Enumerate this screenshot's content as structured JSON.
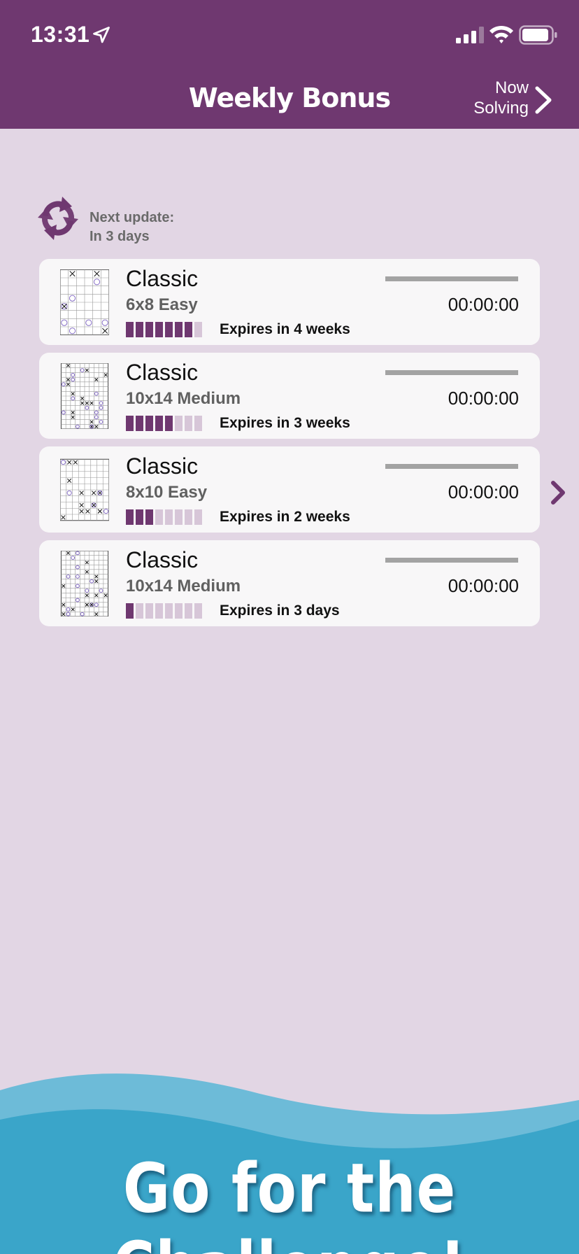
{
  "status": {
    "time": "13:31"
  },
  "header": {
    "title": "Weekly Bonus",
    "now_line1": "Now",
    "now_line2": "Solving"
  },
  "update": {
    "label": "Next update:",
    "value": "In 3 days"
  },
  "colors": {
    "brand": "#6f3870",
    "background": "#e2d6e4",
    "card": "#f8f7f8",
    "segment_off": "#d7c6d8",
    "wave": "#3aa5c9"
  },
  "puzzles": [
    {
      "title": "Classic",
      "subtitle": "6x8 Easy",
      "expires": "Expires in 4 weeks",
      "time": "00:00:00",
      "remaining": 7,
      "segments": 8,
      "cols": 6,
      "rows": 8
    },
    {
      "title": "Classic",
      "subtitle": "10x14 Medium",
      "expires": "Expires in 3 weeks",
      "time": "00:00:00",
      "remaining": 5,
      "segments": 8,
      "cols": 10,
      "rows": 14
    },
    {
      "title": "Classic",
      "subtitle": "8x10 Easy",
      "expires": "Expires in 2 weeks",
      "time": "00:00:00",
      "remaining": 3,
      "segments": 8,
      "cols": 8,
      "rows": 10
    },
    {
      "title": "Classic",
      "subtitle": "10x14 Medium",
      "expires": "Expires in 3 days",
      "time": "00:00:00",
      "remaining": 1,
      "segments": 8,
      "cols": 10,
      "rows": 14
    }
  ],
  "banner": {
    "text": "Go for the Challenge!"
  }
}
